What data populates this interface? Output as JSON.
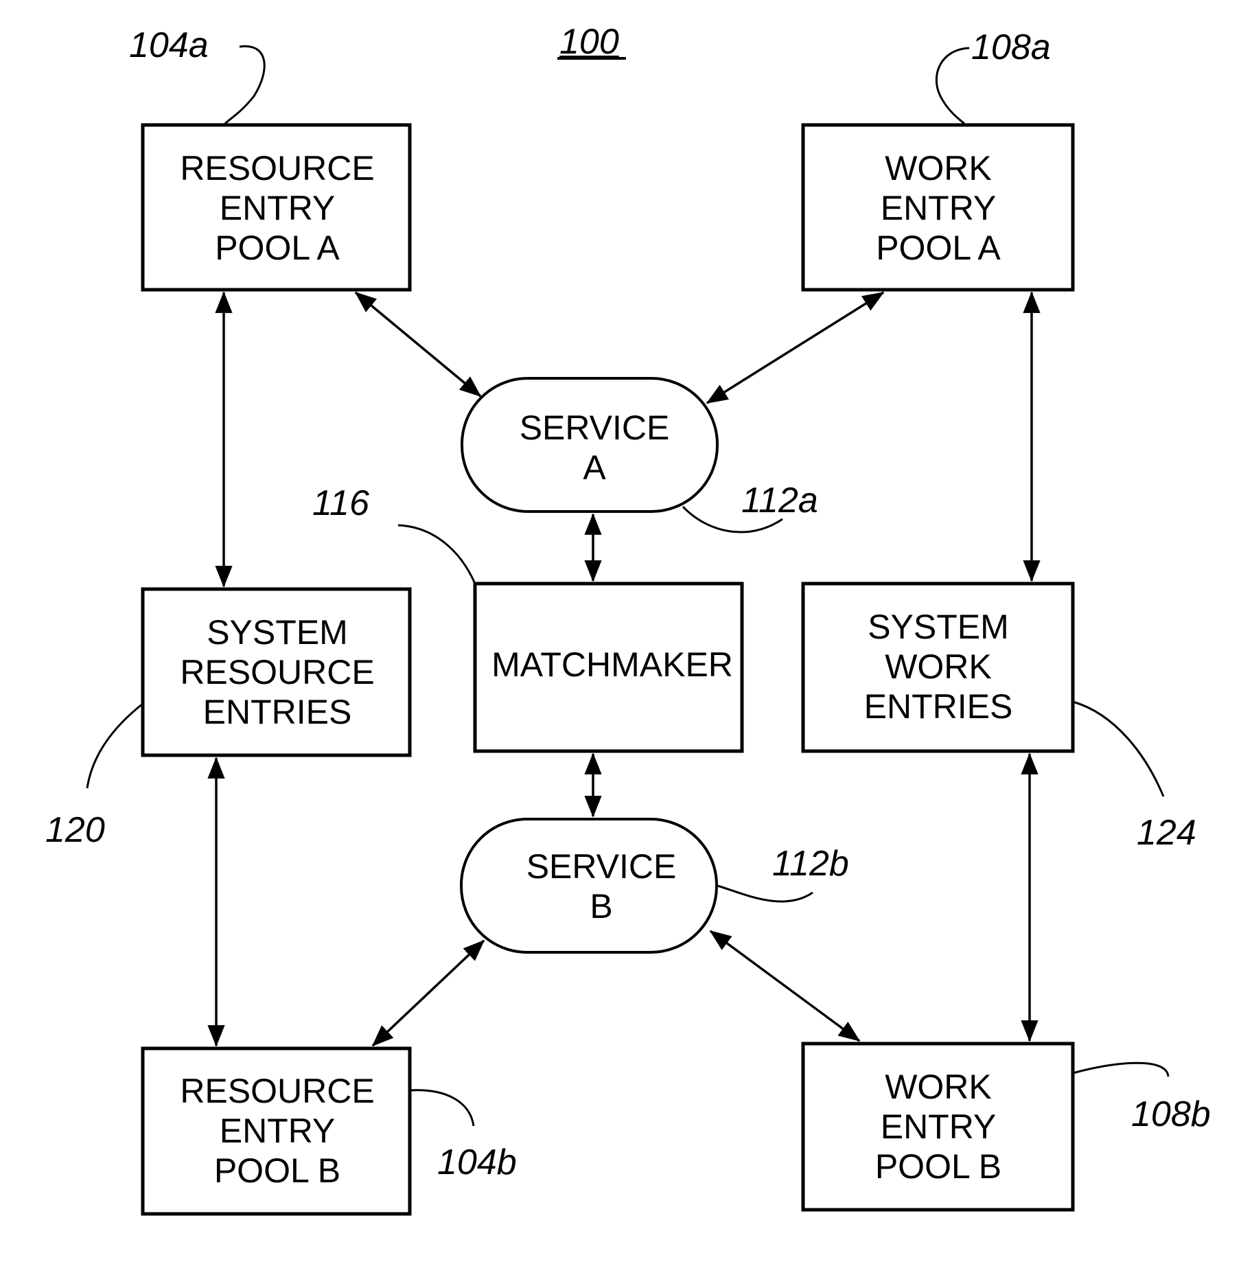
{
  "figure": {
    "number": "100"
  },
  "nodes": {
    "resource_pool_a": {
      "lines": [
        "RESOURCE",
        "ENTRY",
        "POOL A"
      ],
      "ref": "104a"
    },
    "work_pool_a": {
      "lines": [
        "WORK",
        "ENTRY",
        "POOL A"
      ],
      "ref": "108a"
    },
    "service_a": {
      "lines": [
        "SERVICE",
        "A"
      ],
      "ref": "112a"
    },
    "matchmaker": {
      "lines": [
        "MATCHMAKER"
      ],
      "ref": "116"
    },
    "system_resource_entries": {
      "lines": [
        "SYSTEM",
        "RESOURCE",
        "ENTRIES"
      ],
      "ref": "120"
    },
    "system_work_entries": {
      "lines": [
        "SYSTEM",
        "WORK",
        "ENTRIES"
      ],
      "ref": "124"
    },
    "service_b": {
      "lines": [
        "SERVICE",
        "B"
      ],
      "ref": "112b"
    },
    "resource_pool_b": {
      "lines": [
        "RESOURCE",
        "ENTRY",
        "POOL B"
      ],
      "ref": "104b"
    },
    "work_pool_b": {
      "lines": [
        "WORK",
        "ENTRY",
        "POOL B"
      ],
      "ref": "108b"
    }
  },
  "edges": [
    {
      "from": "resource_pool_a",
      "to": "service_a",
      "type": "bidirectional"
    },
    {
      "from": "work_pool_a",
      "to": "service_a",
      "type": "bidirectional"
    },
    {
      "from": "resource_pool_a",
      "to": "system_resource_entries",
      "type": "bidirectional"
    },
    {
      "from": "work_pool_a",
      "to": "system_work_entries",
      "type": "bidirectional"
    },
    {
      "from": "service_a",
      "to": "matchmaker",
      "type": "bidirectional"
    },
    {
      "from": "matchmaker",
      "to": "service_b",
      "type": "bidirectional"
    },
    {
      "from": "system_resource_entries",
      "to": "resource_pool_b",
      "type": "bidirectional"
    },
    {
      "from": "system_work_entries",
      "to": "work_pool_b",
      "type": "bidirectional"
    },
    {
      "from": "service_b",
      "to": "resource_pool_b",
      "type": "bidirectional"
    },
    {
      "from": "service_b",
      "to": "work_pool_b",
      "type": "bidirectional"
    }
  ]
}
